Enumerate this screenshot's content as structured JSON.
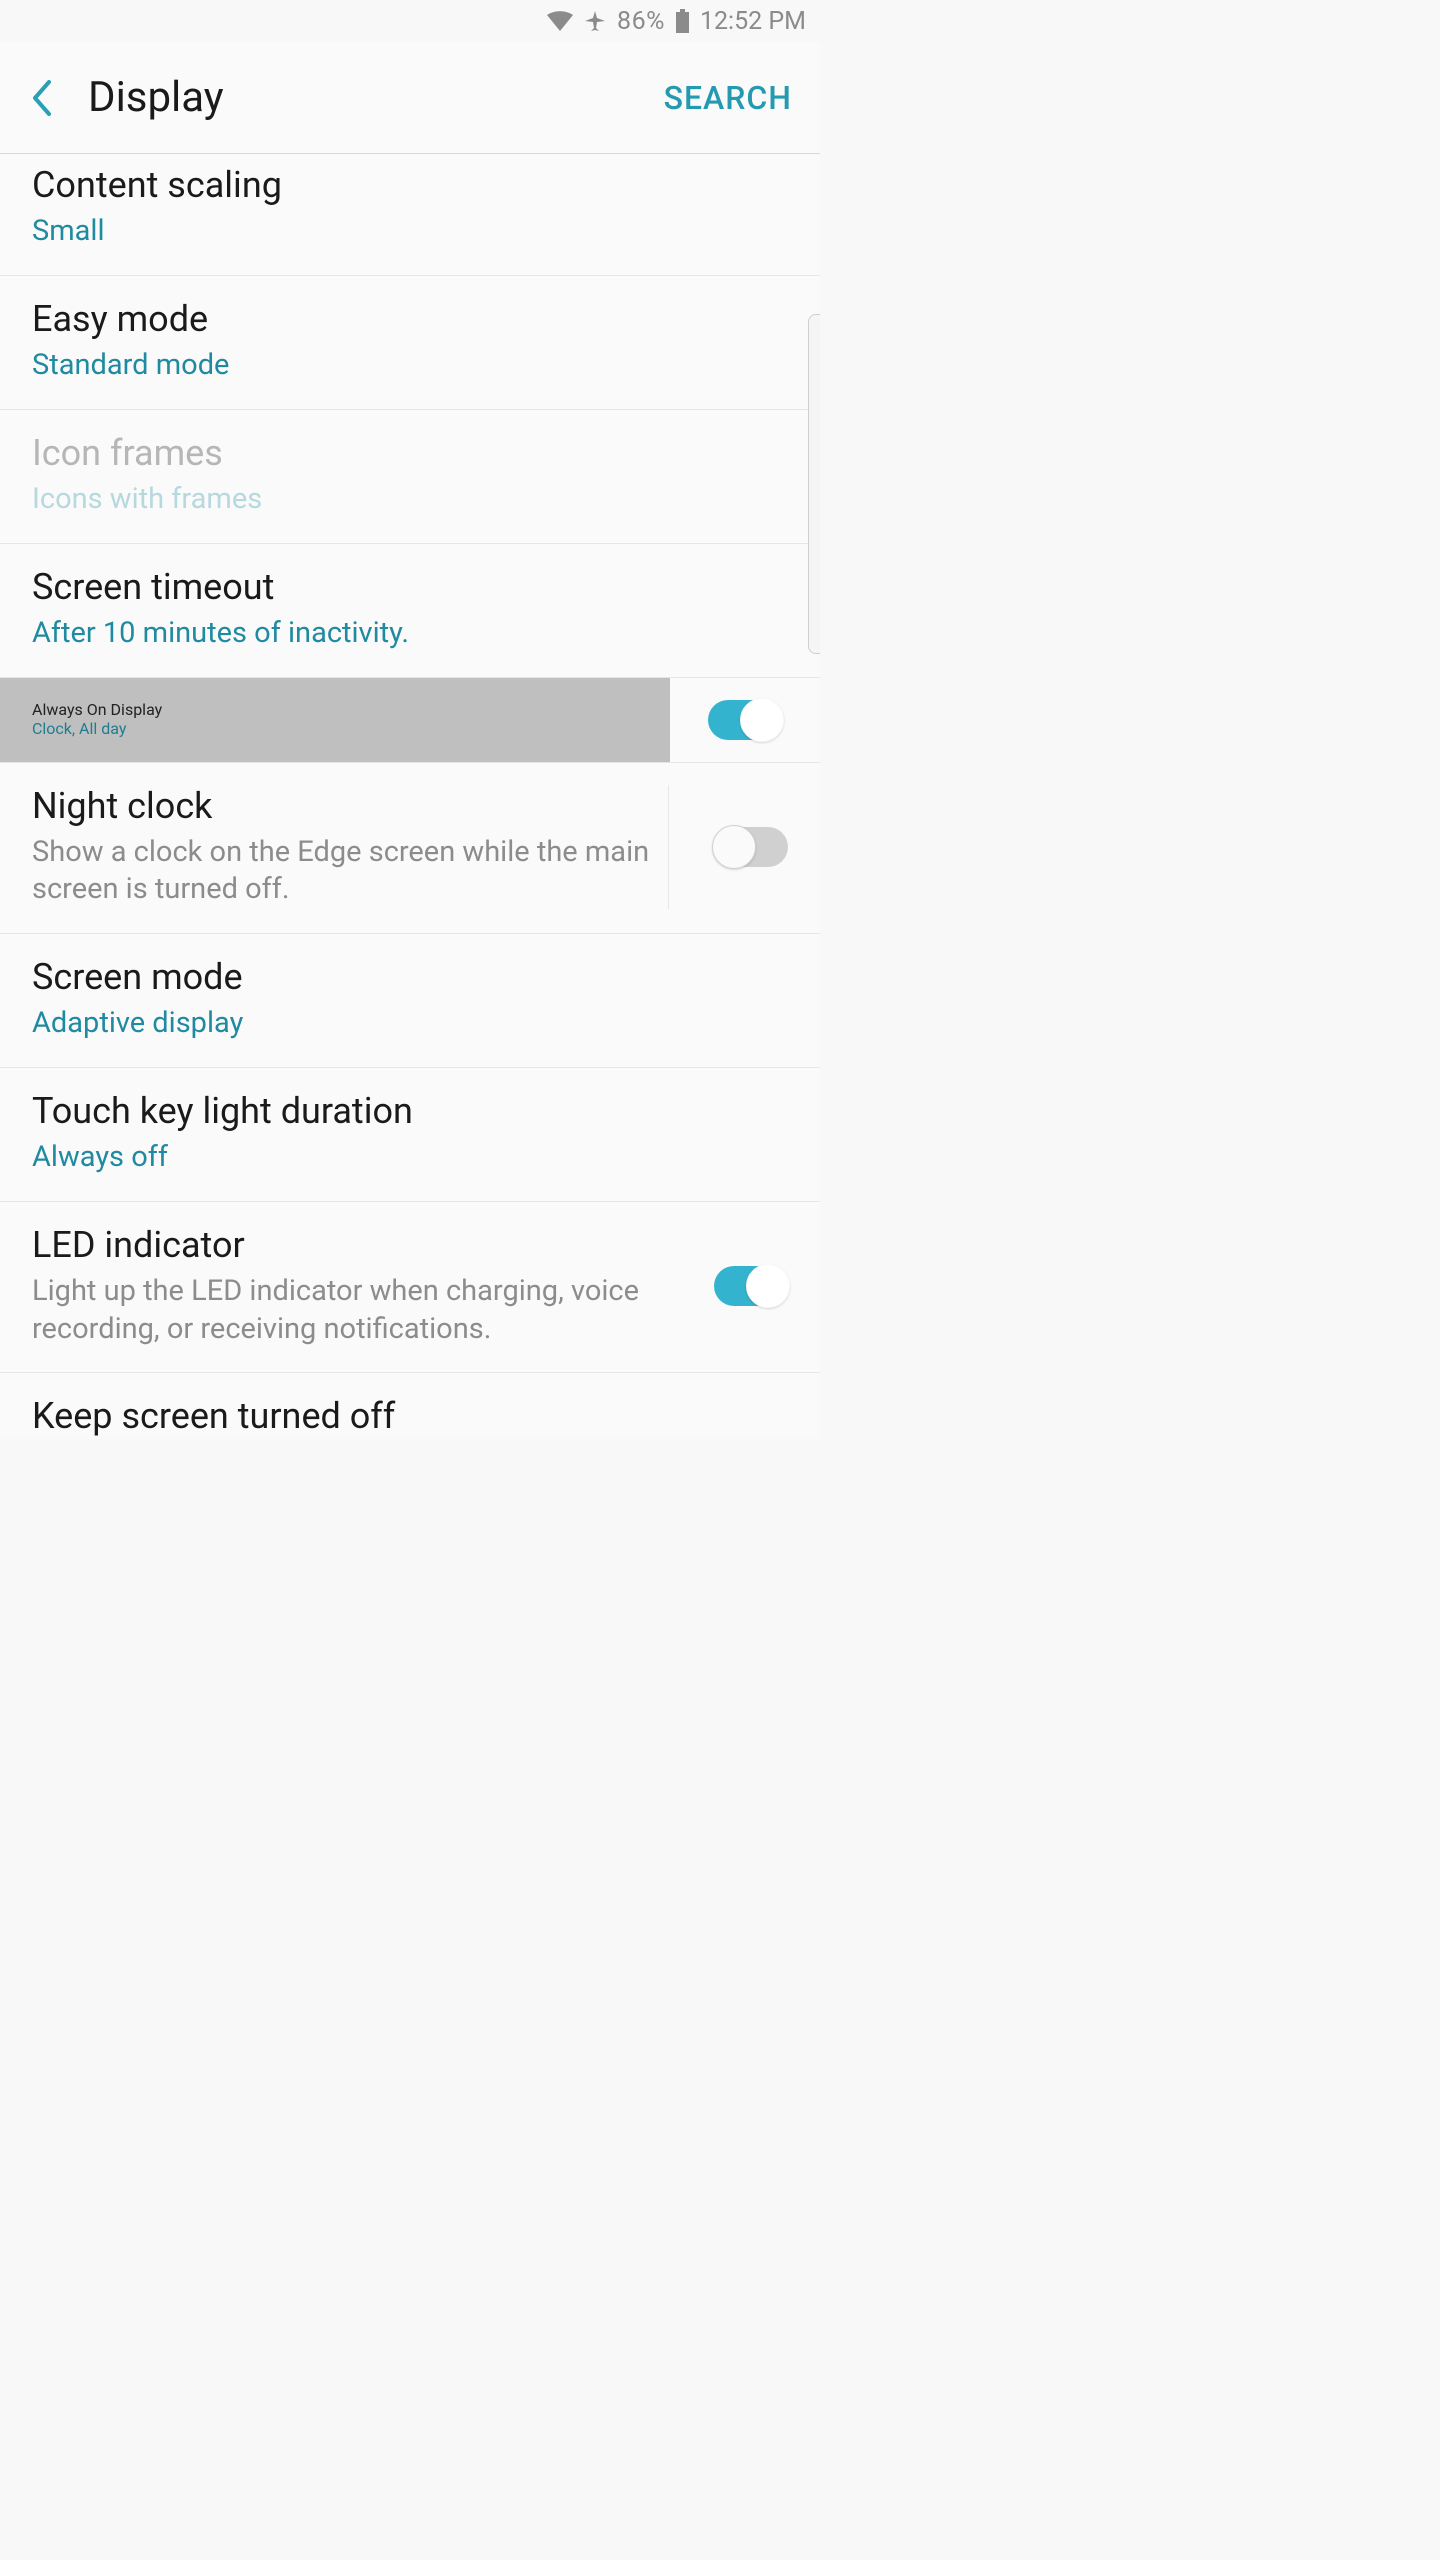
{
  "status": {
    "battery_pct": "86%",
    "time": "12:52 PM"
  },
  "header": {
    "title": "Display",
    "search": "SEARCH"
  },
  "items": {
    "content_scaling": {
      "title": "Content scaling",
      "sub": "Small"
    },
    "easy_mode": {
      "title": "Easy mode",
      "sub": "Standard mode"
    },
    "icon_frames": {
      "title": "Icon frames",
      "sub": "Icons with frames"
    },
    "screen_timeout": {
      "title": "Screen timeout",
      "sub": "After 10 minutes of inactivity."
    },
    "aod": {
      "title": "Always On Display",
      "sub": "Clock, All day"
    },
    "night_clock": {
      "title": "Night clock",
      "sub": "Show a clock on the Edge screen while the main screen is turned off."
    },
    "screen_mode": {
      "title": "Screen mode",
      "sub": "Adaptive display"
    },
    "touch_key": {
      "title": "Touch key light duration",
      "sub": "Always off"
    },
    "led": {
      "title": "LED indicator",
      "sub": "Light up the LED indicator when charging, voice recording, or receiving notifications."
    },
    "keep_on": {
      "title": "Keep screen turned off"
    }
  }
}
